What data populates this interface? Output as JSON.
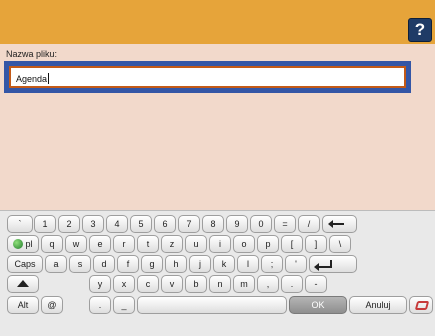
{
  "header": {
    "help_label": "?"
  },
  "field": {
    "label": "Nazwa pliku:",
    "value": "Agenda"
  },
  "keyboard": {
    "row1": [
      "`",
      "1",
      "2",
      "3",
      "4",
      "5",
      "6",
      "7",
      "8",
      "9",
      "0",
      "=",
      "/"
    ],
    "row2_lang": "pl",
    "row2": [
      "q",
      "w",
      "e",
      "r",
      "t",
      "z",
      "u",
      "i",
      "o",
      "p",
      "[",
      "]",
      "\\"
    ],
    "caps_label": "Caps",
    "row3": [
      "a",
      "s",
      "d",
      "f",
      "g",
      "h",
      "j",
      "k",
      "l",
      ";",
      "'"
    ],
    "row4": [
      "y",
      "x",
      "c",
      "v",
      "b",
      "n",
      "m",
      ",",
      ".",
      "-"
    ],
    "alt_label": "Alt",
    "at_label": "@",
    "dot_label": ".",
    "underscore_label": "_",
    "ok_label": "OK",
    "cancel_label": "Anuluj"
  }
}
